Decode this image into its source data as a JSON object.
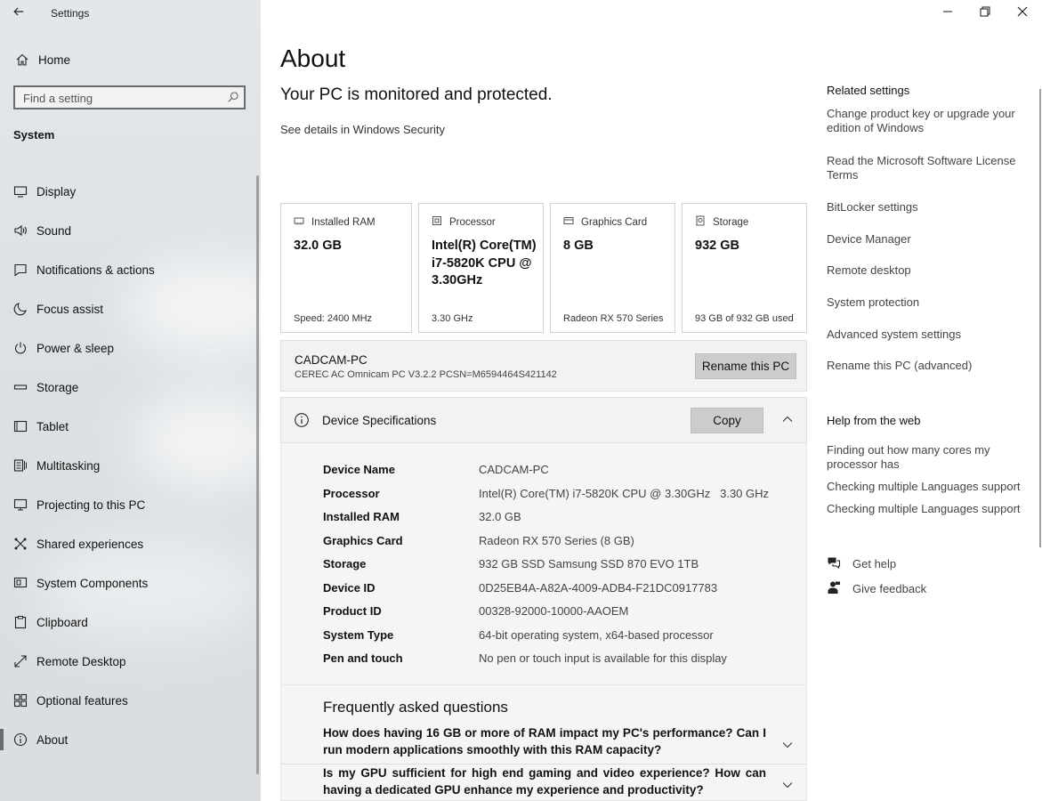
{
  "window": {
    "title": "Settings",
    "controls": [
      "minimize-icon",
      "restore-icon",
      "close-icon"
    ]
  },
  "sidebar": {
    "home_label": "Home",
    "search_placeholder": "Find a setting",
    "section": "System",
    "items": [
      {
        "label": "Display",
        "icon": "display-icon"
      },
      {
        "label": "Sound",
        "icon": "speaker-icon"
      },
      {
        "label": "Notifications & actions",
        "icon": "notification-icon"
      },
      {
        "label": "Focus assist",
        "icon": "moon-icon"
      },
      {
        "label": "Power & sleep",
        "icon": "power-icon"
      },
      {
        "label": "Storage",
        "icon": "storage-icon"
      },
      {
        "label": "Tablet",
        "icon": "tablet-icon"
      },
      {
        "label": "Multitasking",
        "icon": "multitasking-icon"
      },
      {
        "label": "Projecting to this PC",
        "icon": "projecting-icon"
      },
      {
        "label": "Shared experiences",
        "icon": "shared-icon"
      },
      {
        "label": "System Components",
        "icon": "components-icon"
      },
      {
        "label": "Clipboard",
        "icon": "clipboard-icon"
      },
      {
        "label": "Remote Desktop",
        "icon": "remote-icon"
      },
      {
        "label": "Optional features",
        "icon": "optional-icon"
      },
      {
        "label": "About",
        "icon": "info-icon",
        "active": true
      }
    ]
  },
  "main": {
    "title": "About",
    "protection_status": "Your PC is monitored and protected.",
    "security_link": "See details in Windows Security",
    "cards": [
      {
        "label": "Installed RAM",
        "value": "32.0 GB",
        "sub": "Speed: 2400 MHz",
        "icon": "ram-icon"
      },
      {
        "label": "Processor",
        "value": "Intel(R) Core(TM) i7-5820K CPU @ 3.30GHz",
        "sub": "3.30 GHz",
        "icon": "processor-icon"
      },
      {
        "label": "Graphics Card",
        "value": "8 GB",
        "sub": "Radeon RX 570 Series",
        "icon": "graphics-card-icon"
      },
      {
        "label": "Storage",
        "value": "932 GB",
        "sub": "93 GB of 932 GB used",
        "icon": "storage-drive-icon"
      }
    ],
    "pc_name": "CADCAM-PC",
    "pc_model": "CEREC AC Omnicam PC V3.2.2   PCSN=M6594464S421142",
    "rename_button": "Rename this PC",
    "device_specs": {
      "title": "Device Specifications",
      "copy_button": "Copy",
      "rows": [
        {
          "key": "Device Name",
          "value": "CADCAM-PC"
        },
        {
          "key": "Processor",
          "value": "Intel(R) Core(TM) i7-5820K CPU @ 3.30GHz   3.30 GHz"
        },
        {
          "key": "Installed RAM",
          "value": "32.0 GB"
        },
        {
          "key": "Graphics Card",
          "value": "Radeon RX 570 Series (8 GB)"
        },
        {
          "key": "Storage",
          "value": "932 GB SSD Samsung SSD 870 EVO 1TB"
        },
        {
          "key": "Device ID",
          "value": "0D25EB4A-A82A-4009-ADB4-F21DC0917783"
        },
        {
          "key": "Product ID",
          "value": "00328-92000-10000-AAOEM"
        },
        {
          "key": "System Type",
          "value": "64-bit operating system, x64-based processor"
        },
        {
          "key": "Pen and touch",
          "value": "No pen or touch input is available for this display"
        }
      ]
    },
    "faq": {
      "title": "Frequently asked questions",
      "questions": [
        "How does having 16 GB or more of RAM impact my PC's performance? Can I run modern applications smoothly with this RAM capacity?",
        "Is my GPU sufficient for high end gaming and video experience? How can having a dedicated GPU enhance my experience and productivity?"
      ]
    }
  },
  "right": {
    "related_title": "Related settings",
    "related_links": [
      "Change product key or upgrade your edition of Windows",
      "Read the Microsoft Software License Terms",
      "BitLocker settings",
      "Device Manager",
      "Remote desktop",
      "System protection",
      "Advanced system settings",
      "Rename this PC (advanced)"
    ],
    "help_title": "Help from the web",
    "help_links": [
      "Finding out how many cores my processor has",
      "Checking multiple Languages support",
      "Checking multiple Languages support"
    ],
    "get_help": "Get help",
    "give_feedback": "Give feedback"
  }
}
